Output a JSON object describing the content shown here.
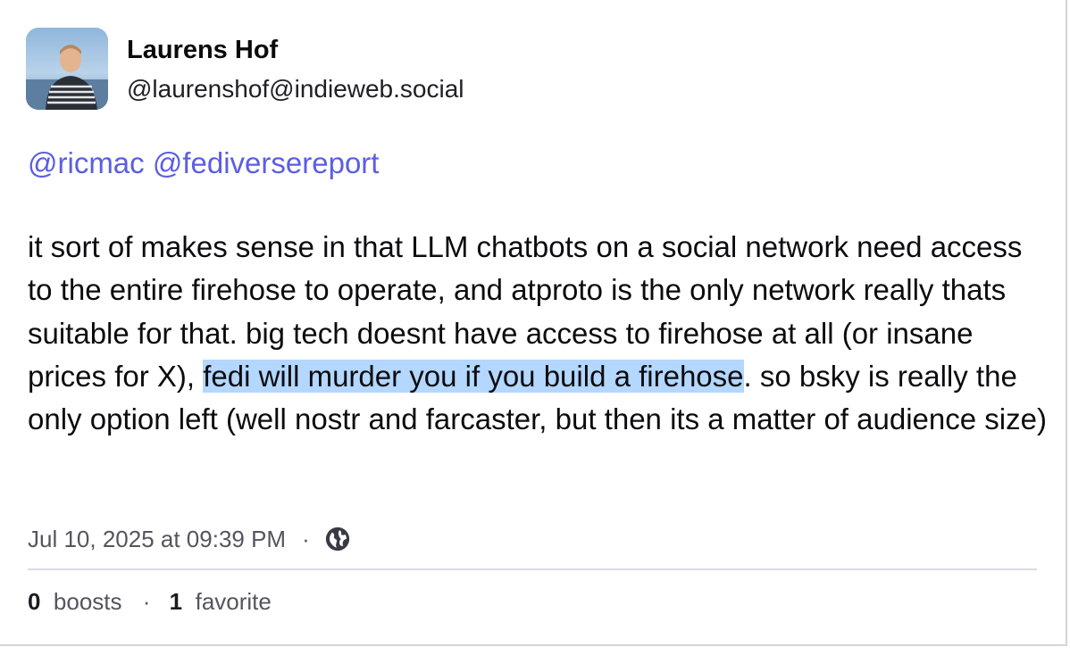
{
  "author": {
    "display_name": "Laurens Hof",
    "handle": "@laurenshof@indieweb.social"
  },
  "post": {
    "mentions": [
      "@ricmac",
      "@fediversereport"
    ],
    "text_before_highlight": "it sort of makes sense in that LLM chatbots on a social network need access to the entire firehose to operate, and atproto is the only network really thats suitable for that. big tech doesnt have access to firehose at all (or insane prices for X), ",
    "text_highlighted": "fedi will murder you if you build a firehose",
    "text_after_highlight": ". so bsky is really the only option left (well nostr and farcaster, but then its a matter of audience size)",
    "highlight_color": "#b3d7ff",
    "mention_color": "#5b5ee2"
  },
  "meta": {
    "timestamp": "Jul 10, 2025 at 09:39 PM",
    "separator": "·",
    "visibility_icon": "globe-icon"
  },
  "stats": {
    "boosts_count": "0",
    "boosts_label": "boosts",
    "separator": "·",
    "favorites_count": "1",
    "favorites_label": "favorite"
  }
}
